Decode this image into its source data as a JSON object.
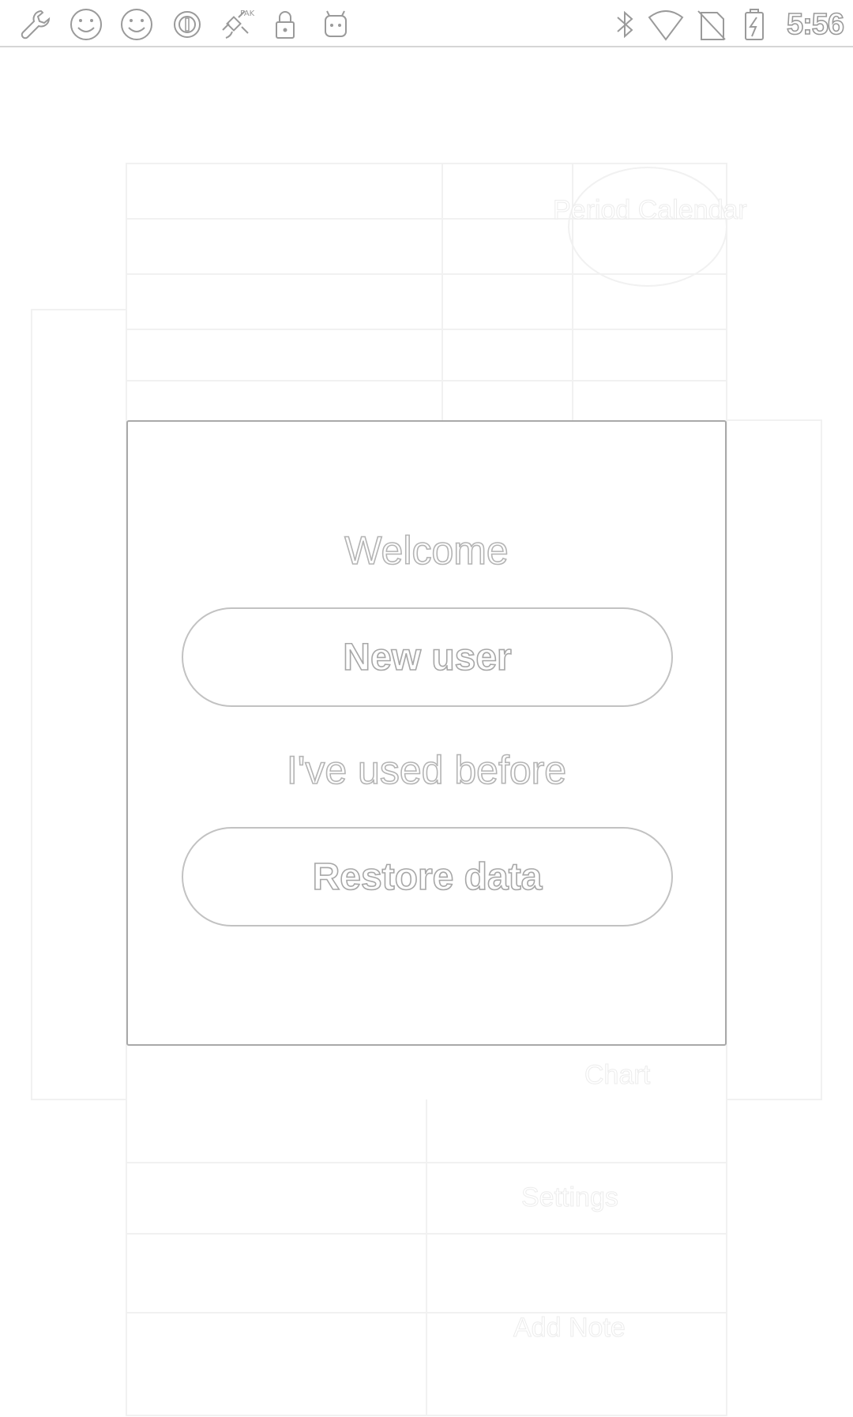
{
  "status_bar": {
    "time": "5:56",
    "left_icons": [
      "wrench-icon",
      "smiley-icon",
      "smiley-icon",
      "circle-target-icon",
      "satellite-icon",
      "lock-icon",
      "android-icon"
    ],
    "right_icons": [
      "bluetooth-icon",
      "wifi-icon",
      "no-sim-icon",
      "battery-charging-icon"
    ]
  },
  "background_app": {
    "labels": [
      "Period Calendar",
      "Chart",
      "Settings",
      "Add Note"
    ]
  },
  "dialog": {
    "title": "Welcome",
    "new_user_label": "New user",
    "used_before_text": "I've used before",
    "restore_label": "Restore data"
  },
  "colors": {
    "outline": "#a9a9a9",
    "background": "#ffffff"
  }
}
